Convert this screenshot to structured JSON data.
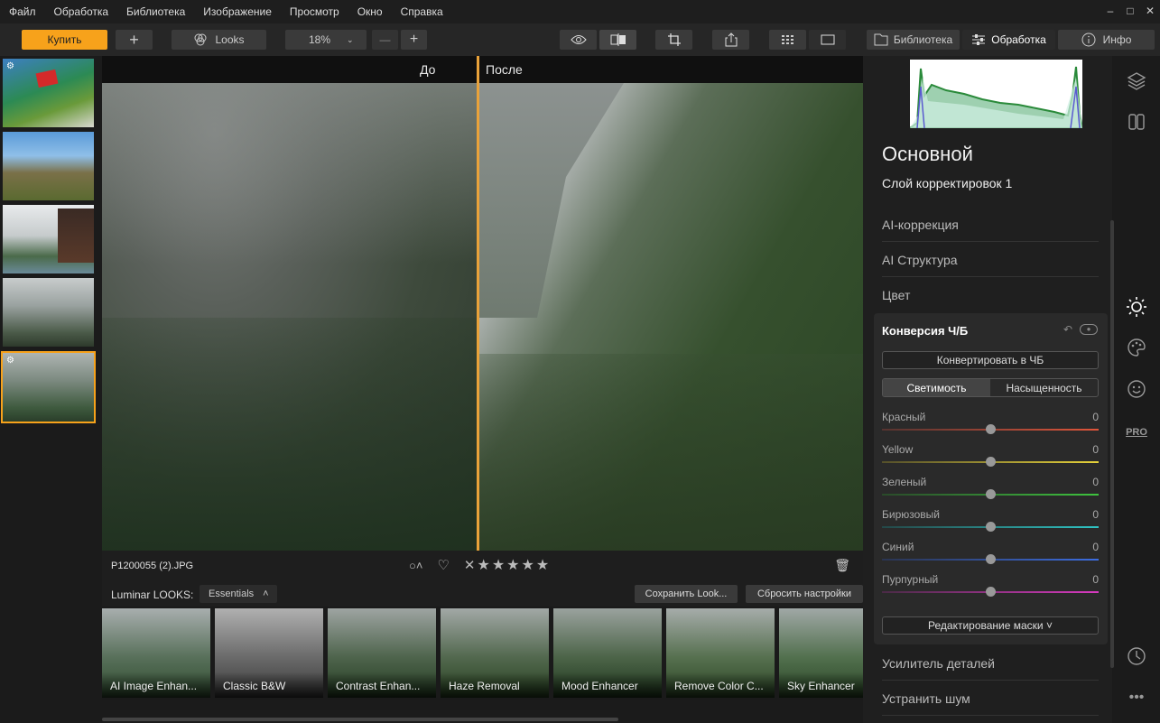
{
  "menu": [
    "Файл",
    "Обработка",
    "Библиотека",
    "Изображение",
    "Просмотр",
    "Окно",
    "Справка"
  ],
  "window_controls": {
    "minimize": "–",
    "maximize": "□",
    "close": "✕"
  },
  "toolbar": {
    "buy_label": "Купить",
    "add_label": "+",
    "looks_label": "Looks",
    "zoom_value": "18%",
    "zoom_out": "—",
    "zoom_in": "+",
    "tab_library": "Библиотека",
    "tab_edit": "Обработка",
    "tab_info": "Инфо",
    "accent": "#f7a21b"
  },
  "compare": {
    "before": "До",
    "after": "После"
  },
  "info": {
    "filename": "P1200055 (2).JPG",
    "stars": 5
  },
  "looks": {
    "label": "Luminar LOOKS:",
    "collection": "Essentials",
    "save_label": "Сохранить Look...",
    "reset_label": "Сбросить настройки",
    "items": [
      "AI Image Enhan...",
      "Classic B&W",
      "Contrast Enhan...",
      "Haze Removal",
      "Mood Enhancer",
      "Remove Color C...",
      "Sky Enhancer"
    ]
  },
  "panel": {
    "title": "Основной",
    "layer": "Слой корректировок 1",
    "sections_top": [
      "AI-коррекция",
      "AI Структура",
      "Цвет"
    ],
    "card_title": "Конверсия Ч/Б",
    "convert_label": "Конвертировать в ЧБ",
    "seg_luminance": "Светимость",
    "seg_saturation": "Насыщенность",
    "sliders": [
      {
        "name": "Красный",
        "value": "0",
        "color": "#e0553a"
      },
      {
        "name": "Yellow",
        "value": "0",
        "color": "#e6d23a"
      },
      {
        "name": "Зеленый",
        "value": "0",
        "color": "#3ec33e"
      },
      {
        "name": "Бирюзовый",
        "value": "0",
        "color": "#2fc4c4"
      },
      {
        "name": "Синий",
        "value": "0",
        "color": "#3c6de0"
      },
      {
        "name": "Пурпурный",
        "value": "0",
        "color": "#d83ac0"
      }
    ],
    "mask_label": "Редактирование маски ˅",
    "sections_bottom": [
      "Усилитель деталей",
      "Устранить шум"
    ]
  },
  "right_icons": {
    "pro_label": "PRO"
  }
}
